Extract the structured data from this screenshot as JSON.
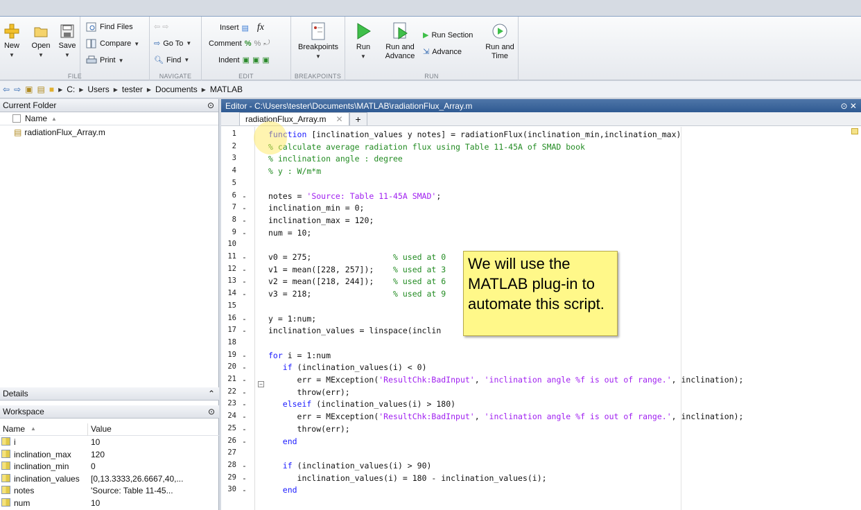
{
  "ribbon": {
    "new": "New",
    "open": "Open",
    "save": "Save",
    "find_files": "Find Files",
    "compare": "Compare",
    "print": "Print",
    "go_to": "Go To",
    "find": "Find",
    "insert": "Insert",
    "comment": "Comment",
    "indent": "Indent",
    "fx": "fx",
    "breakpoints": "Breakpoints",
    "run": "Run",
    "run_and_advance": "Run and Advance",
    "run_section": "Run Section",
    "advance": "Advance",
    "run_and_time": "Run and Time",
    "groups": {
      "file": "FILE",
      "navigate": "NAVIGATE",
      "edit": "EDIT",
      "breakpoints": "BREAKPOINTS",
      "run": "RUN"
    }
  },
  "address": {
    "parts": [
      "C:",
      "Users",
      "tester",
      "Documents",
      "MATLAB"
    ]
  },
  "current_folder": {
    "title": "Current Folder",
    "name_col": "Name",
    "files": [
      "radiationFlux_Array.m"
    ]
  },
  "details": {
    "title": "Details"
  },
  "workspace": {
    "title": "Workspace",
    "name_col": "Name",
    "value_col": "Value",
    "rows": [
      {
        "name": "i",
        "value": "10"
      },
      {
        "name": "inclination_max",
        "value": "120"
      },
      {
        "name": "inclination_min",
        "value": "0"
      },
      {
        "name": "inclination_values",
        "value": "[0,13.3333,26.6667,40,..."
      },
      {
        "name": "notes",
        "value": "'Source: Table 11-45..."
      },
      {
        "name": "num",
        "value": "10"
      }
    ]
  },
  "editor": {
    "title": "Editor - C:\\Users\\tester\\Documents\\MATLAB\\radiationFlux_Array.m",
    "tab": "radiationFlux_Array.m",
    "lines": [
      {
        "n": "1",
        "d": "",
        "html": "<span class=\"kw\">function</span> [inclination_values y notes] = radiationFlux(inclination_min,inclination_max)"
      },
      {
        "n": "2",
        "d": "",
        "html": "<span class=\"cm\">% calculate average radiation flux using Table 11-45A of SMAD book</span>"
      },
      {
        "n": "3",
        "d": "",
        "html": "<span class=\"cm\">% inclination angle : degree</span>"
      },
      {
        "n": "4",
        "d": "",
        "html": "<span class=\"cm\">% y : W/m*m</span>"
      },
      {
        "n": "5",
        "d": "",
        "html": ""
      },
      {
        "n": "6",
        "d": "-",
        "html": "notes = <span class=\"st\">'Source: Table 11-45A SMAD'</span>;"
      },
      {
        "n": "7",
        "d": "-",
        "html": "inclination_min = 0;"
      },
      {
        "n": "8",
        "d": "-",
        "html": "inclination_max = 120;"
      },
      {
        "n": "9",
        "d": "-",
        "html": "num = 10;"
      },
      {
        "n": "10",
        "d": "",
        "html": ""
      },
      {
        "n": "11",
        "d": "-",
        "html": "v0 = 275;                 <span class=\"cm\">% used at 0</span>"
      },
      {
        "n": "12",
        "d": "-",
        "html": "v1 = mean([228, 257]);    <span class=\"cm\">% used at 3</span>"
      },
      {
        "n": "13",
        "d": "-",
        "html": "v2 = mean([218, 244]);    <span class=\"cm\">% used at 6</span>"
      },
      {
        "n": "14",
        "d": "-",
        "html": "v3 = 218;                 <span class=\"cm\">% used at 9</span>"
      },
      {
        "n": "15",
        "d": "",
        "html": ""
      },
      {
        "n": "16",
        "d": "-",
        "html": "y = 1:num;"
      },
      {
        "n": "17",
        "d": "-",
        "html": "inclination_values = linspace(inclin                        num);"
      },
      {
        "n": "18",
        "d": "",
        "html": ""
      },
      {
        "n": "19",
        "d": "-",
        "html": "<span class=\"kw\">for</span> i = 1:num"
      },
      {
        "n": "20",
        "d": "-",
        "html": "   <span class=\"kw\">if</span> (inclination_values(i) &lt; 0)"
      },
      {
        "n": "21",
        "d": "-",
        "html": "      err = MException(<span class=\"st\">'ResultChk:BadInput'</span>, <span class=\"st\">'inclination angle %f is out of range.'</span>, inclination);"
      },
      {
        "n": "22",
        "d": "-",
        "html": "      throw(err);"
      },
      {
        "n": "23",
        "d": "-",
        "html": "   <span class=\"kw\">elseif</span> (inclination_values(i) &gt; 180)"
      },
      {
        "n": "24",
        "d": "-",
        "html": "      err = MException(<span class=\"st\">'ResultChk:BadInput'</span>, <span class=\"st\">'inclination angle %f is out of range.'</span>, inclination);"
      },
      {
        "n": "25",
        "d": "-",
        "html": "      throw(err);"
      },
      {
        "n": "26",
        "d": "-",
        "html": "   <span class=\"kw\">end</span>"
      },
      {
        "n": "27",
        "d": "",
        "html": ""
      },
      {
        "n": "28",
        "d": "-",
        "html": "   <span class=\"kw\">if</span> (inclination_values(i) &gt; 90)"
      },
      {
        "n": "29",
        "d": "-",
        "html": "      inclination_values(i) = 180 - inclination_values(i);"
      },
      {
        "n": "30",
        "d": "-",
        "html": "   <span class=\"kw\">end</span>"
      }
    ]
  },
  "callout": {
    "text": "We will use the MATLAB plug-in to automate this script."
  }
}
